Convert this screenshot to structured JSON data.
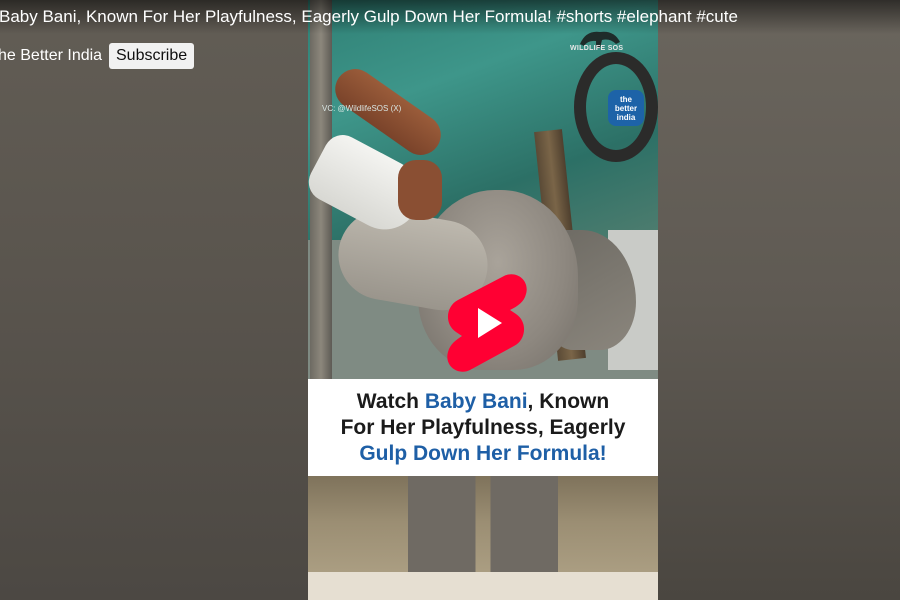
{
  "header": {
    "title": "Baby Bani, Known For Her Playfulness, Eagerly Gulp Down Her Formula! #shorts #elephant #cute",
    "channel_name": "he Better India",
    "subscribe_label": "Subscribe"
  },
  "video": {
    "credit_text": "VC: @WildlifeSOS (X)",
    "watermark_text": "WILDLIFE SOS",
    "logo_text": "the better india",
    "caption_line1_pre": "Watch ",
    "caption_line1_hl": "Baby Bani",
    "caption_line1_post": ", Known",
    "caption_line2": "For Her Playfulness, Eagerly",
    "caption_line3_hl": "Gulp Down Her Formula!",
    "play_icon": "youtube-shorts-icon"
  },
  "colors": {
    "shorts_red": "#ff0033",
    "caption_highlight": "#1e5fa6"
  }
}
